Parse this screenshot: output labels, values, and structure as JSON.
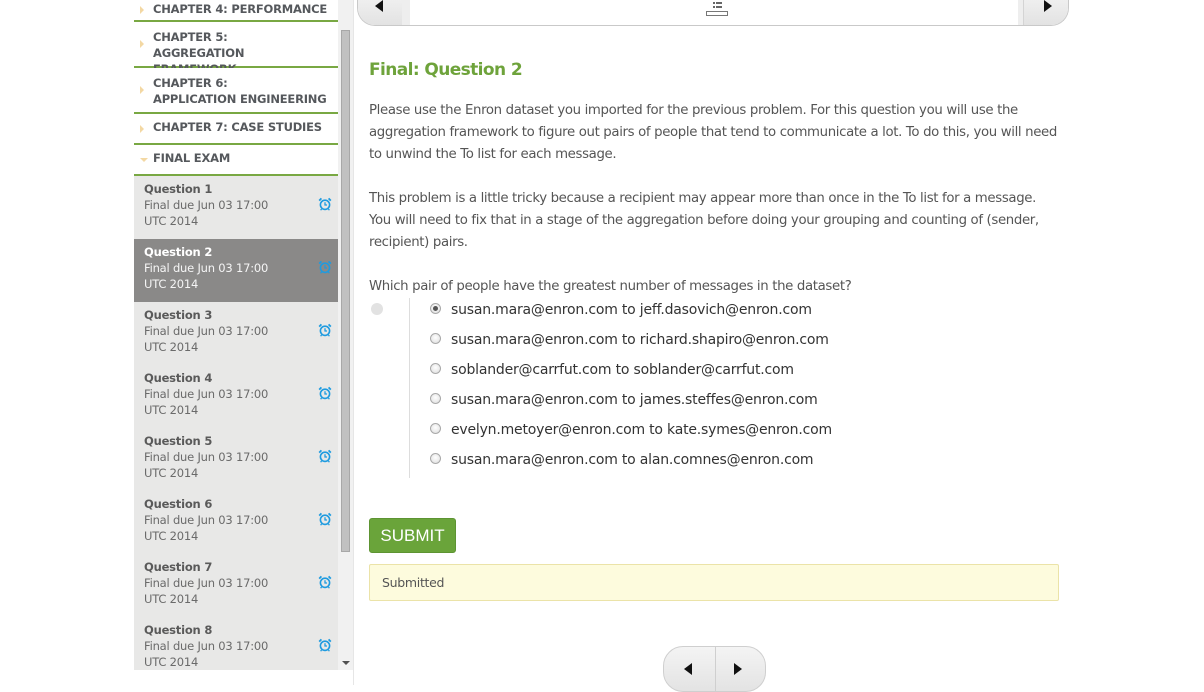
{
  "sidebar": {
    "chapters": [
      {
        "label": "CHAPTER 4: PERFORMANCE",
        "expanded": false
      },
      {
        "label_line1": "CHAPTER 5:",
        "label_line2": "AGGREGATION FRAMEWORK",
        "expanded": false
      },
      {
        "label_line1": "CHAPTER 6:",
        "label_line2": "APPLICATION ENGINEERING",
        "expanded": false
      },
      {
        "label": "CHAPTER 7: CASE STUDIES",
        "expanded": false
      },
      {
        "label": "FINAL EXAM",
        "expanded": true
      }
    ],
    "questions": [
      {
        "title": "Question 1",
        "due_line1": "Final due Jun 03 17:00",
        "due_line2": "UTC 2014",
        "icon": "alarm-clock-icon",
        "active": false
      },
      {
        "title": "Question 2",
        "due_line1": "Final due Jun 03 17:00",
        "due_line2": "UTC 2014",
        "icon": "alarm-clock-icon",
        "active": true
      },
      {
        "title": "Question 3",
        "due_line1": "Final due Jun 03 17:00",
        "due_line2": "UTC 2014",
        "icon": "alarm-clock-icon",
        "active": false
      },
      {
        "title": "Question 4",
        "due_line1": "Final due Jun 03 17:00",
        "due_line2": "UTC 2014",
        "icon": "alarm-clock-icon",
        "active": false
      },
      {
        "title": "Question 5",
        "due_line1": "Final due Jun 03 17:00",
        "due_line2": "UTC 2014",
        "icon": "alarm-clock-icon",
        "active": false
      },
      {
        "title": "Question 6",
        "due_line1": "Final due Jun 03 17:00",
        "due_line2": "UTC 2014",
        "icon": "alarm-clock-icon",
        "active": false
      },
      {
        "title": "Question 7",
        "due_line1": "Final due Jun 03 17:00",
        "due_line2": "UTC 2014",
        "icon": "alarm-clock-icon",
        "active": false
      },
      {
        "title": "Question 8",
        "due_line1": "Final due Jun 03 17:00",
        "due_line2": "UTC 2014",
        "icon": "alarm-clock-icon",
        "active": false
      }
    ]
  },
  "topnav": {
    "prev_icon": "triangle-left-icon",
    "next_icon": "triangle-right-icon",
    "sequence_icon": "list-icon"
  },
  "problem": {
    "title": "Final: Question 2",
    "paragraph1": "Please use the Enron dataset you imported for the previous problem. For this question you will use the aggregation framework to figure out pairs of people that tend to communicate a lot. To do this, you will need to unwind the To list for each message.",
    "paragraph2": "This problem is a little tricky because a recipient may appear more than once in the To list for a message. You will need to fix that in a stage of the aggregation before doing your grouping and counting of (sender, recipient) pairs.",
    "question": "Which pair of people have the greatest number of messages in the dataset?",
    "choices": [
      {
        "label": "susan.mara@enron.com to jeff.dasovich@enron.com",
        "selected": true
      },
      {
        "label": "susan.mara@enron.com to richard.shapiro@enron.com",
        "selected": false
      },
      {
        "label": "soblander@carrfut.com to soblander@carrfut.com",
        "selected": false
      },
      {
        "label": "susan.mara@enron.com to james.steffes@enron.com",
        "selected": false
      },
      {
        "label": "evelyn.metoyer@enron.com to kate.symes@enron.com",
        "selected": false
      },
      {
        "label": "susan.mara@enron.com to alan.comnes@enron.com",
        "selected": false
      }
    ],
    "submit_label": "SUBMIT",
    "status_message": "Submitted"
  },
  "colors": {
    "accent_green": "#6ea33b",
    "button_green": "#6aa43a",
    "alarm_blue": "#1e9be0",
    "active_item_bg": "#8a8988",
    "notice_bg": "#fdfbdd"
  }
}
